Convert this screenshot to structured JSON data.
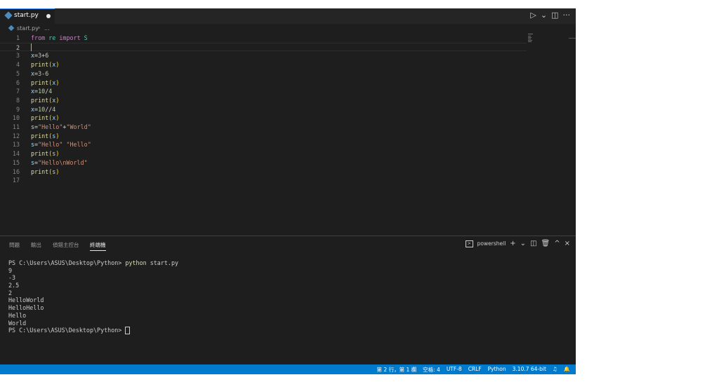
{
  "tab": {
    "filename": "start.py"
  },
  "tab_actions": {
    "run": "▷",
    "run_dropdown": "⌄",
    "split": "◫",
    "more": "···"
  },
  "breadcrumb": {
    "file": "start.py",
    "separator": "›",
    "more": "..."
  },
  "editor": {
    "current_line": 2,
    "lines": [
      {
        "n": "1"
      },
      {
        "n": "2"
      },
      {
        "n": "3"
      },
      {
        "n": "4"
      },
      {
        "n": "5"
      },
      {
        "n": "6"
      },
      {
        "n": "7"
      },
      {
        "n": "8"
      },
      {
        "n": "9"
      },
      {
        "n": "10"
      },
      {
        "n": "11"
      },
      {
        "n": "12"
      },
      {
        "n": "13"
      },
      {
        "n": "14"
      },
      {
        "n": "15"
      },
      {
        "n": "16"
      },
      {
        "n": "17"
      }
    ],
    "tokens": {
      "l1": [
        "from",
        "re",
        "import",
        "S"
      ],
      "l3": [
        "x",
        "=",
        "3",
        "+",
        "6"
      ],
      "l4": [
        "print",
        "(",
        "x",
        ")"
      ],
      "l5": [
        "x",
        "=",
        "3",
        "-",
        "6"
      ],
      "l6": [
        "print",
        "(",
        "x",
        ")"
      ],
      "l7": [
        "x",
        "=",
        "10",
        "/",
        "4"
      ],
      "l8": [
        "print",
        "(",
        "x",
        ")"
      ],
      "l9": [
        "x",
        "=",
        "10",
        "//",
        "4"
      ],
      "l10": [
        "print",
        "(",
        "x",
        ")"
      ],
      "l11": [
        "s",
        "=",
        "\"Hello\"",
        "+",
        "\"World\""
      ],
      "l12": [
        "print",
        "(",
        "s",
        ")"
      ],
      "l13": [
        "s",
        "=",
        "\"Hello\"",
        " ",
        "\"Hello\""
      ],
      "l14": [
        "print",
        "(",
        "s",
        ")"
      ],
      "l15": [
        "s",
        "=",
        "\"Hello\\nWorld\""
      ],
      "l16": [
        "print",
        "(",
        "s",
        ")"
      ]
    }
  },
  "panel": {
    "tabs": [
      "問題",
      "輸出",
      "偵錯主控台",
      "終端機"
    ],
    "active_tab": "終端機",
    "terminal_name": "powershell",
    "actions": {
      "terminal_icon": ">",
      "add": "+",
      "add_dropdown": "⌄",
      "split": "◫",
      "trash": "🗑",
      "maximize": "^",
      "close": "×"
    }
  },
  "terminal": {
    "prompt": "PS C:\\Users\\ASUS\\Desktop\\Python> ",
    "command": "python",
    "command_args": " start.py",
    "output": [
      "9",
      "-3",
      "2.5",
      "2",
      "HelloWorld",
      "HelloHello",
      "Hello",
      "World"
    ],
    "final_prompt": "PS C:\\Users\\ASUS\\Desktop\\Python> "
  },
  "statusbar": {
    "position": "第 2 行，第 1 欄",
    "spaces": "空格: 4",
    "encoding": "UTF-8",
    "eol": "CRLF",
    "language": "Python",
    "interpreter": "3.10.7 64-bit",
    "feedback_icon": "♫",
    "bell_icon": "🔔"
  },
  "colors": {
    "accent": "#007acc",
    "editor_bg": "#1e1e1e",
    "keyword": "#c586c0",
    "function": "#dcdcaa",
    "variable": "#9cdcfe",
    "number": "#b5cea8",
    "string": "#ce9178"
  }
}
